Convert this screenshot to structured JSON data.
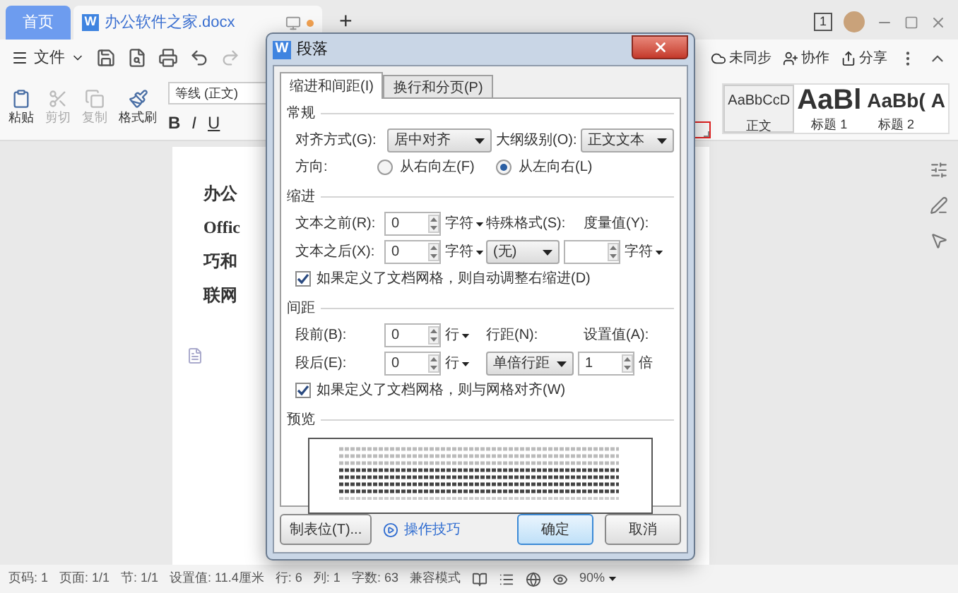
{
  "tabs": [
    {
      "label": "首页",
      "selected": false,
      "kind": "home"
    },
    {
      "label": "办公软件之家.docx",
      "selected": true,
      "kind": "doc",
      "icon_letter": "W"
    }
  ],
  "new_tab": "+",
  "window_badge": "1",
  "menu": {
    "file": "文件"
  },
  "top_actions": [
    "未同步",
    "协作",
    "分享"
  ],
  "ribbon": {
    "tools": [
      {
        "label": "粘贴",
        "kind": "paste",
        "disabled": false
      },
      {
        "label": "剪切",
        "kind": "cut",
        "disabled": true
      },
      {
        "label": "复制",
        "kind": "copy",
        "disabled": true
      },
      {
        "label": "格式刷",
        "kind": "painter",
        "disabled": false
      }
    ],
    "font": "等线 (正文)",
    "format": [
      "B",
      "I",
      "U"
    ]
  },
  "styles": [
    {
      "sample": "AaBbCcD",
      "name": "正文",
      "kind": "body",
      "selected": true
    },
    {
      "sample": "AaBl",
      "name": "标题 1",
      "kind": "h1",
      "selected": false
    },
    {
      "sample": "AaBb(",
      "name": "标题 2",
      "kind": "h2",
      "selected": false
    },
    {
      "sample": "A",
      "kind": "h3",
      "selected": false
    }
  ],
  "document": {
    "lines": [
      "办公",
      "Offic",
      "巧和",
      "联网"
    ]
  },
  "dialog": {
    "title": "段落",
    "icon_letter": "W",
    "tabs": [
      {
        "label": "缩进和间距(I)",
        "selected": true
      },
      {
        "label": "换行和分页(P)",
        "selected": false
      }
    ],
    "general": {
      "heading": "常规",
      "alignment": {
        "label": "对齐方式(G):",
        "value": "居中对齐"
      },
      "outline": {
        "label": "大纲级别(O):",
        "value": "正文文本"
      },
      "direction": {
        "label": "方向:",
        "options": [
          {
            "label": "从右向左(F)",
            "selected": false
          },
          {
            "label": "从左向右(L)",
            "selected": true
          }
        ]
      }
    },
    "indent": {
      "heading": "缩进",
      "before": {
        "label": "文本之前(R):",
        "value": "0",
        "unit": "字符"
      },
      "after": {
        "label": "文本之后(X):",
        "value": "0",
        "unit": "字符"
      },
      "special": {
        "label": "特殊格式(S):",
        "value": "(无)"
      },
      "measure": {
        "label": "度量值(Y):",
        "unit": "字符"
      },
      "grid_check": {
        "label": "如果定义了文档网格，则自动调整右缩进(D)",
        "checked": true
      }
    },
    "spacing": {
      "heading": "间距",
      "before": {
        "label": "段前(B):",
        "value": "0",
        "unit": "行"
      },
      "after": {
        "label": "段后(E):",
        "value": "0",
        "unit": "行"
      },
      "line": {
        "label": "行距(N):",
        "value": "单倍行距"
      },
      "setting": {
        "label": "设置值(A):",
        "value": "1",
        "unit": "倍"
      },
      "grid_check": {
        "label": "如果定义了文档网格，则与网格对齐(W)",
        "checked": true
      }
    },
    "preview": {
      "heading": "预览"
    },
    "buttons": {
      "tabs": "制表位(T)...",
      "tips": "操作技巧",
      "ok": "确定",
      "cancel": "取消"
    }
  },
  "status_bar": {
    "items": [
      "页码: 1",
      "页面: 1/1",
      "节: 1/1",
      "设置值: 11.4厘米",
      "行: 6",
      "列: 1",
      "字数: 63",
      "兼容模式"
    ],
    "zoom": "90%"
  }
}
